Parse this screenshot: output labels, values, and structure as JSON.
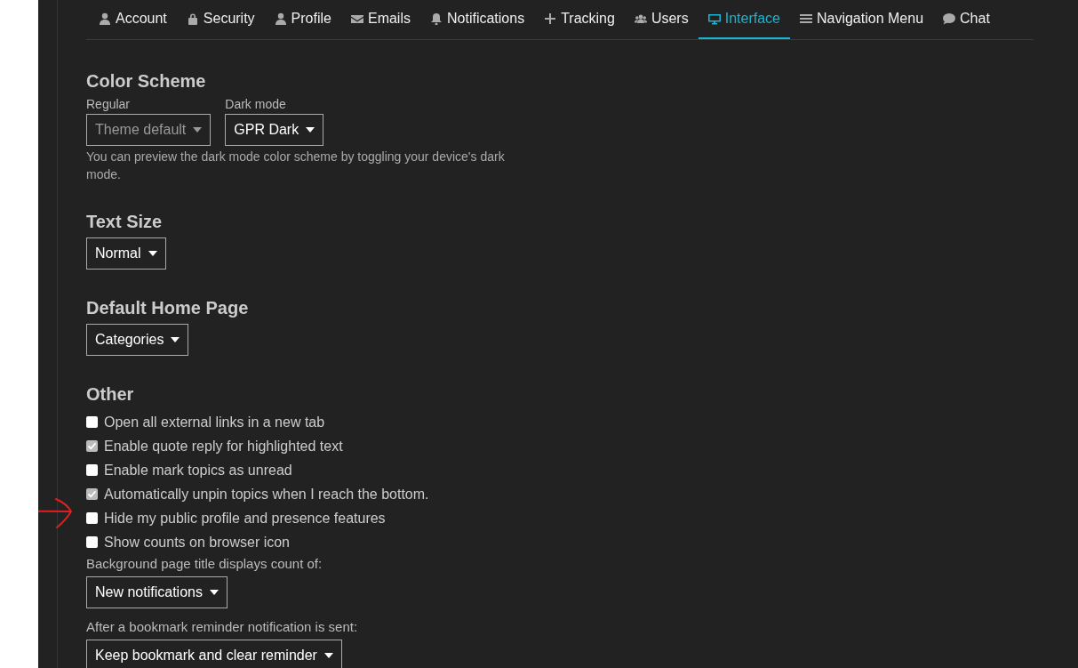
{
  "tabs": [
    {
      "label": "Account",
      "selected": false
    },
    {
      "label": "Security",
      "selected": false
    },
    {
      "label": "Profile",
      "selected": false
    },
    {
      "label": "Emails",
      "selected": false
    },
    {
      "label": "Notifications",
      "selected": false
    },
    {
      "label": "Tracking",
      "selected": false
    },
    {
      "label": "Users",
      "selected": false
    },
    {
      "label": "Interface",
      "selected": true
    },
    {
      "label": "Navigation Menu",
      "selected": false
    },
    {
      "label": "Chat",
      "selected": false
    }
  ],
  "sections": [
    {
      "title": "Color Scheme",
      "items": [
        {
          "kind": "selects",
          "selects": [
            {
              "label": "Regular",
              "value": "Theme default",
              "disabled": true
            },
            {
              "label": "Dark mode",
              "value": "GPR Dark",
              "disabled": false
            }
          ]
        },
        {
          "kind": "note",
          "text": "You can preview the dark mode color scheme by toggling your device's dark mode."
        }
      ]
    },
    {
      "title": "Text Size",
      "items": [
        {
          "kind": "select",
          "value": "Normal"
        }
      ]
    },
    {
      "title": "Default Home Page",
      "items": [
        {
          "kind": "select",
          "value": "Categories"
        }
      ]
    },
    {
      "title": "Other",
      "items": [
        {
          "kind": "checkbox",
          "label": "Open all external links in a new tab",
          "checked": false
        },
        {
          "kind": "checkbox",
          "label": "Enable quote reply for highlighted text",
          "checked": true
        },
        {
          "kind": "checkbox",
          "label": "Enable mark topics as unread",
          "checked": false
        },
        {
          "kind": "checkbox",
          "label": "Automatically unpin topics when I reach the bottom.",
          "checked": true
        },
        {
          "kind": "checkbox",
          "label": "Hide my public profile and presence features",
          "checked": false,
          "annotated": true
        },
        {
          "kind": "checkbox",
          "label": "Show counts on browser icon",
          "checked": false
        },
        {
          "kind": "label",
          "text": "Background page title displays count of:"
        },
        {
          "kind": "select",
          "value": "New notifications"
        },
        {
          "kind": "label",
          "text": "After a bookmark reminder notification is sent:"
        },
        {
          "kind": "select",
          "value": "Keep bookmark and clear reminder"
        }
      ]
    }
  ]
}
